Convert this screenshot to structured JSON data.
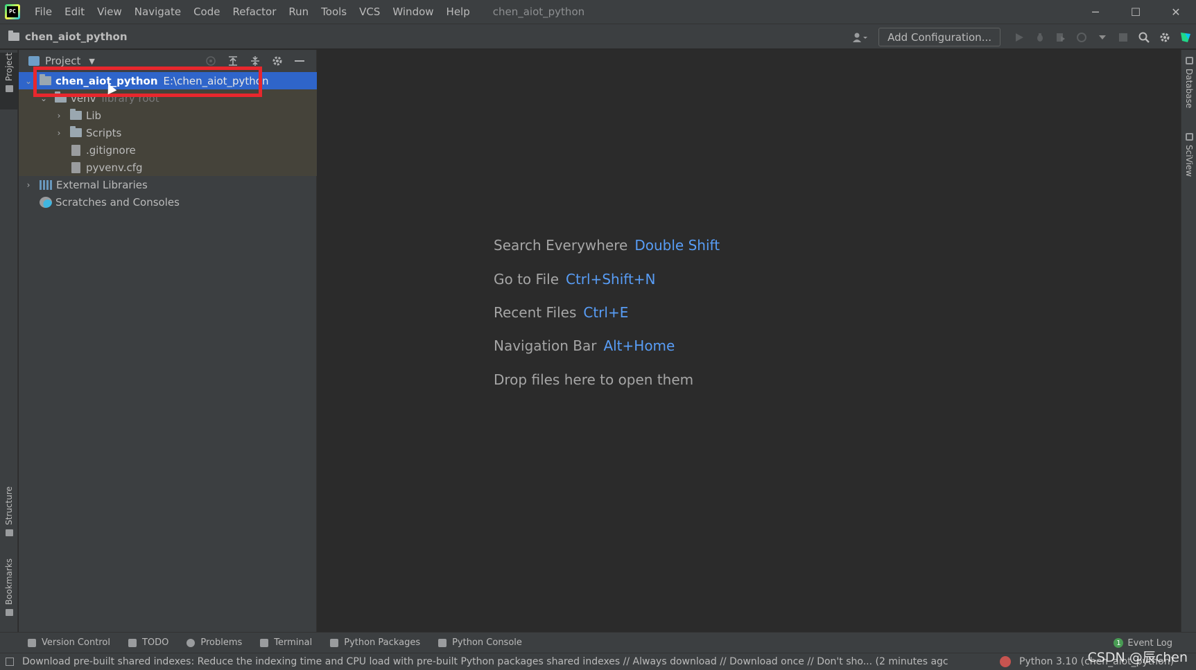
{
  "menu": {
    "logo_text": "PC",
    "items": [
      "File",
      "Edit",
      "View",
      "Navigate",
      "Code",
      "Refactor",
      "Run",
      "Tools",
      "VCS",
      "Window",
      "Help"
    ],
    "window_title": "chen_aiot_python"
  },
  "window_controls": {
    "minimize": "─",
    "maximize": "☐",
    "close": "✕"
  },
  "navbar": {
    "project": "chen_aiot_python",
    "add_configuration": "Add Configuration..."
  },
  "left_strip": {
    "project_tab": "Project",
    "structure_tab": "Structure",
    "bookmarks_tab": "Bookmarks"
  },
  "right_strip": {
    "database_tab": "Database",
    "sciview_tab": "SciView"
  },
  "project_panel": {
    "title": "Project",
    "tree": {
      "root_name": "chen_aiot_python",
      "root_path": "E:\\chen_aiot_python",
      "venv_name": "venv",
      "venv_note": "library root",
      "lib": "Lib",
      "scripts": "Scripts",
      "gitignore": ".gitignore",
      "pyvenv": "pyvenv.cfg",
      "external": "External Libraries",
      "scratches": "Scratches and Consoles"
    }
  },
  "editor_hints": [
    {
      "label": "Search Everywhere",
      "key": "Double Shift"
    },
    {
      "label": "Go to File",
      "key": "Ctrl+Shift+N"
    },
    {
      "label": "Recent Files",
      "key": "Ctrl+E"
    },
    {
      "label": "Navigation Bar",
      "key": "Alt+Home"
    },
    {
      "label": "Drop files here to open them",
      "key": ""
    }
  ],
  "bottom_tabs": [
    "Version Control",
    "TODO",
    "Problems",
    "Terminal",
    "Python Packages",
    "Python Console"
  ],
  "event_log": {
    "count": "1",
    "label": "Event Log"
  },
  "status": {
    "message": "Download pre-built shared indexes: Reduce the indexing time and CPU load with pre-built Python packages shared indexes // Always download // Download once // Don't sho... (2 minutes agc",
    "interpreter": "Python 3.10 (chen_aiot_python)"
  },
  "watermark": "CSDN @辰chen",
  "colors": {
    "accent": "#589df6",
    "selection": "#2f65ca",
    "highlight": "#e8272d"
  }
}
